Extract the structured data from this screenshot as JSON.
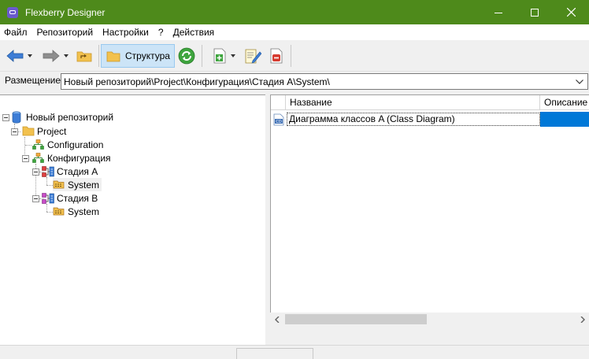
{
  "window": {
    "title": "Flexberry Designer"
  },
  "menu": [
    "Файл",
    "Репозиторий",
    "Настройки",
    "?",
    "Действия"
  ],
  "toolbar": {
    "structure_label": "Структура",
    "active_color": "#cce4f7"
  },
  "location": {
    "label": "Размещение",
    "value": "Новый репозиторий\\Project\\Конфигурация\\Стадия A\\System\\"
  },
  "tree": {
    "root": "Новый репозиторий",
    "project": "Project",
    "configuration": "Configuration",
    "konfig": "Конфигурация",
    "stage_a": "Стадия A",
    "system_a": "System",
    "stage_b": "Стадия B",
    "system_b": "System"
  },
  "list": {
    "columns": [
      "Название",
      "Описание"
    ],
    "rows": [
      {
        "name": "Диаграмма классов A (Class Diagram)",
        "description": ""
      }
    ]
  },
  "colors": {
    "titlebar": "#4e8a1b",
    "selection": "#0078d7"
  }
}
